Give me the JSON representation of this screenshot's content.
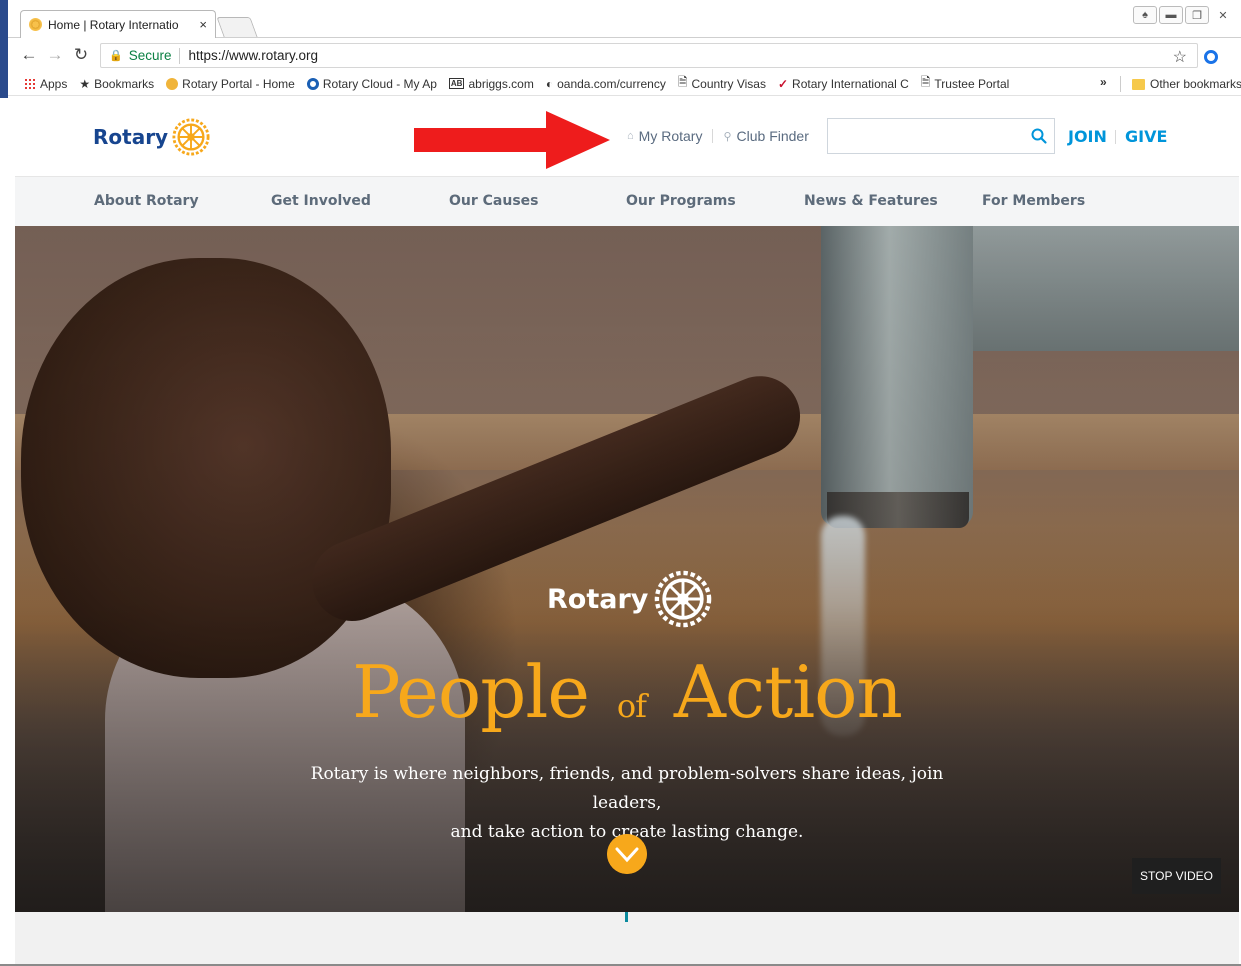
{
  "browser": {
    "tab": {
      "title": "Home | Rotary Internatio",
      "close": "×"
    },
    "window_controls": [
      "user-icon",
      "minimize-icon",
      "restore-icon",
      "close-icon"
    ],
    "address": {
      "secure_label": "Secure",
      "url": "https://www.rotary.org"
    },
    "bookmarks": [
      {
        "label": "Apps",
        "icon": "apps-icon"
      },
      {
        "label": "Bookmarks",
        "icon": "star-icon"
      },
      {
        "label": "Rotary Portal - Home",
        "icon": "rotary-favicon"
      },
      {
        "label": "Rotary Cloud - My Ap",
        "icon": "cloud-favicon"
      },
      {
        "label": "abriggs.com",
        "icon": "ab-favicon"
      },
      {
        "label": "oanda.com/currency",
        "icon": "oanda-favicon"
      },
      {
        "label": "Country Visas",
        "icon": "page-icon"
      },
      {
        "label": "Rotary International C",
        "icon": "ri-favicon"
      },
      {
        "label": "Trustee Portal",
        "icon": "page-icon"
      }
    ],
    "overflow": "»",
    "other_bookmarks": "Other bookmarks"
  },
  "header": {
    "logo_text": "Rotary",
    "utility": {
      "my_rotary": "My Rotary",
      "club_finder": "Club Finder"
    },
    "search": {
      "placeholder": "",
      "value": ""
    },
    "join": "JOIN",
    "give": "GIVE"
  },
  "annotation": {
    "arrow_color": "#ee1c1c"
  },
  "nav": [
    {
      "label": "About Rotary"
    },
    {
      "label": "Get Involved"
    },
    {
      "label": "Our Causes"
    },
    {
      "label": "Our Programs"
    },
    {
      "label": "News & Features"
    },
    {
      "label": "For Members"
    }
  ],
  "hero": {
    "logo_text": "Rotary",
    "title_1": "People",
    "title_of": "of",
    "title_2": "Action",
    "subtitle_1": "Rotary is where neighbors, friends, and problem-solvers share ideas, join leaders,",
    "subtitle_2": "and take action to create lasting change.",
    "stop_video": "STOP VIDEO"
  },
  "colors": {
    "rotary_blue": "#17458f",
    "rotary_gold": "#f7a81b",
    "link_blue": "#0095da"
  }
}
